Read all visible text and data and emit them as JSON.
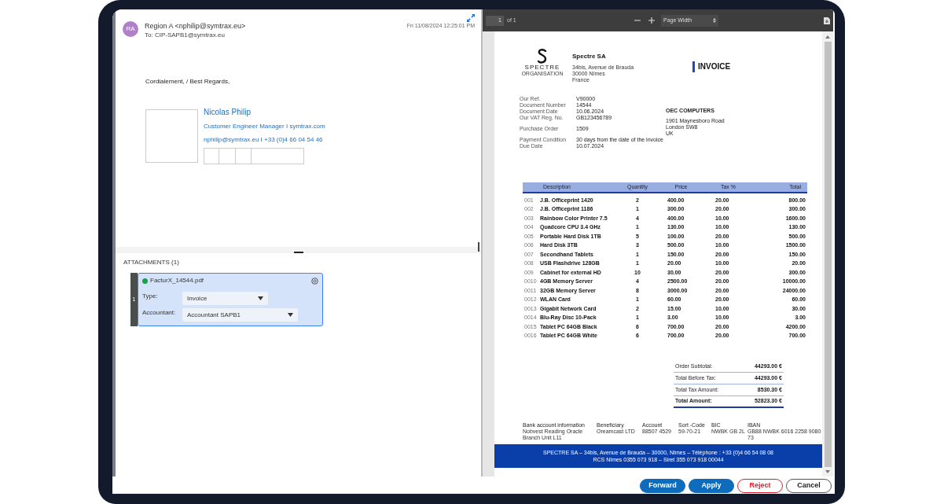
{
  "email": {
    "avatar": "RA",
    "from": "Region A <nphilip@symtrax.eu>",
    "to": "To: CIP-SAPB1@symtrax.eu",
    "date": "Fri 11/08/2024 12:25:01 PM",
    "greeting": "Cordialement, / Best Regards,",
    "signature": {
      "name": "Nicolas Philip",
      "title": "Customer Engineer Manager I symtrax.com",
      "contact": "nphilip@symtrax.eu I +33 (0)4 66 04 54 46"
    }
  },
  "attachments": {
    "heading": "ATTACHMENTS (1)",
    "items": [
      {
        "index": "1",
        "filename": "FacturX_14544.pdf",
        "color": "#16a34a",
        "selected": true,
        "fields": [
          {
            "label": "Type:",
            "value": "Invoice"
          },
          {
            "label": "Accountant:",
            "value": "Accountant SAPB1"
          }
        ]
      }
    ]
  },
  "viewer": {
    "page": "1",
    "page_count": "of 1",
    "zoom": "Page Width"
  },
  "invoice": {
    "logo": {
      "name": "SPECTRE",
      "sub": "ORGANISATION"
    },
    "company": "Spectre SA",
    "address": [
      "34bis, Avenue de Brauda",
      "30000 Nîmes",
      "France"
    ],
    "title": "INVOICE",
    "details": [
      {
        "label": "Our Ref.",
        "value": "V90000"
      },
      {
        "label": "Document Number",
        "value": "14544"
      },
      {
        "label": "Document Date",
        "value": "10.06.2024"
      },
      {
        "label": "Our VAT Reg. No.",
        "value": "GB123456789"
      },
      {
        "label": "Purchase Order",
        "value": "1509"
      },
      {
        "label": "Payment Condition",
        "value": "30 days from the date of the invoice"
      },
      {
        "label": "Due Date",
        "value": "10.07.2024"
      }
    ],
    "customer": {
      "name": "OEC COMPUTERS",
      "address": [
        "1901 Maynesboro Road",
        "London SW8",
        "UK"
      ]
    },
    "columns": [
      "",
      "Description",
      "Quantity",
      "Price",
      "Tax %",
      "Total"
    ],
    "rows": [
      [
        "001",
        "J.B. Officeprint 1420",
        "2",
        "400.00",
        "20.00",
        "800.00"
      ],
      [
        "002",
        "J.B. Officeprint 1186",
        "1",
        "300.00",
        "20.00",
        "300.00"
      ],
      [
        "003",
        "Rainbow Color Printer 7.5",
        "4",
        "400.00",
        "10.00",
        "1600.00"
      ],
      [
        "004",
        "Quadcore CPU 3.4 GHz",
        "1",
        "130.00",
        "10.00",
        "130.00"
      ],
      [
        "005",
        "Portable Hard Disk 1TB",
        "5",
        "100.00",
        "20.00",
        "500.00"
      ],
      [
        "006",
        "Hard Disk 3TB",
        "3",
        "500.00",
        "10.00",
        "1500.00"
      ],
      [
        "007",
        "Secondhand Tablets",
        "1",
        "150.00",
        "20.00",
        "150.00"
      ],
      [
        "008",
        "USB Flashdrive 128GB",
        "1",
        "20.00",
        "10.00",
        "20.00"
      ],
      [
        "009",
        "Cabinet for external HD",
        "10",
        "30.00",
        "20.00",
        "300.00"
      ],
      [
        "0010",
        "4GB Memory Server",
        "4",
        "2500.00",
        "20.00",
        "10000.00"
      ],
      [
        "0011",
        "32GB Memory Server",
        "8",
        "3000.00",
        "20.00",
        "24000.00"
      ],
      [
        "0012",
        "WLAN Card",
        "1",
        "60.00",
        "20.00",
        "60.00"
      ],
      [
        "0013",
        "Gigabit Network Card",
        "2",
        "15.00",
        "10.00",
        "30.00"
      ],
      [
        "0014",
        "Blu-Ray Disc 10-Pack",
        "1",
        "3.00",
        "10.00",
        "3.00"
      ],
      [
        "0015",
        "Tablet PC 64GB Black",
        "6",
        "700.00",
        "20.00",
        "4200.00"
      ],
      [
        "0016",
        "Tablet PC 64GB White",
        "6",
        "700.00",
        "20.00",
        "700.00"
      ]
    ],
    "totals": [
      {
        "label": "Order Subtotal:",
        "value": "44293.00 €",
        "kind": "plain"
      },
      {
        "label": "Total Before Tax:",
        "value": "44293.00 €",
        "kind": "plain"
      },
      {
        "label": "Total Tax Amount:",
        "value": "8530.30 €",
        "kind": "plain"
      },
      {
        "label": "Total Amount:",
        "value": "52823.30 €",
        "kind": "grand"
      }
    ],
    "bank": [
      {
        "label": "Bank account information",
        "value": "Nobvest Reading Oracle Branch Unit L11"
      },
      {
        "label": "Beneficiary",
        "value": "Oreamcast LTD"
      },
      {
        "label": "Account",
        "value": "88507 4529"
      },
      {
        "label": "Sort -Code",
        "value": "59-70-21"
      },
      {
        "label": "BIC",
        "value": "NWBK GB 2L"
      },
      {
        "label": "IBAN",
        "value": "GB88 NWBK 6016 2258 9080 73"
      }
    ],
    "footer": [
      "SPECTRE SA – 34bis, Avenue de Brauda – 30000, Nîmes – Téléphone : +33 (0)4 66 54 08 08",
      "RCS Nîmes 0355 073 918 – Siret 355 073 918 00044"
    ]
  },
  "actions": [
    {
      "label": "Forward",
      "kind": "primary"
    },
    {
      "label": "Apply",
      "kind": "primary"
    },
    {
      "label": "Reject",
      "kind": "danger"
    },
    {
      "label": "Cancel",
      "kind": "outline"
    }
  ]
}
